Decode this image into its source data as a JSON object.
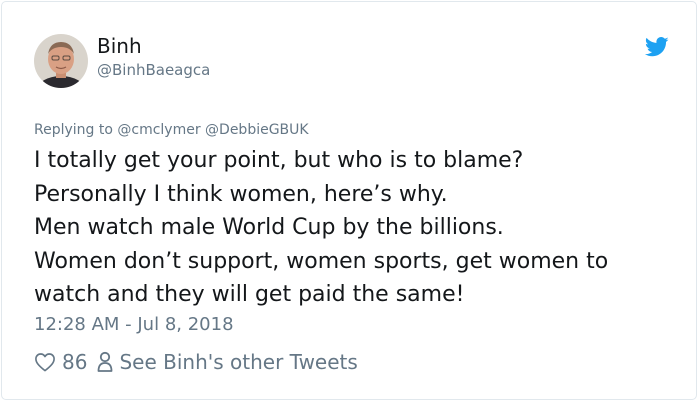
{
  "author": {
    "name": "Binh",
    "handle": "@BinhBaeagca"
  },
  "reply_context": "Replying to @cmclymer @DebbieGBUK",
  "tweet_lines": [
    "I totally get your point, but who is to blame?",
    "Personally I think women, here’s why.",
    "Men watch male World Cup by the billions.",
    "Women don’t support, women sports, get women to",
    "watch and they will get paid the same!"
  ],
  "timestamp": "12:28 AM - Jul 8, 2018",
  "actions": {
    "like_count": "86",
    "other_tweets_label": "See Binh's other Tweets"
  },
  "colors": {
    "twitter_blue": "#1da1f2",
    "text": "#14171a",
    "muted": "#657786"
  },
  "icons": [
    "twitter-bird-icon",
    "heart-icon",
    "person-icon"
  ]
}
